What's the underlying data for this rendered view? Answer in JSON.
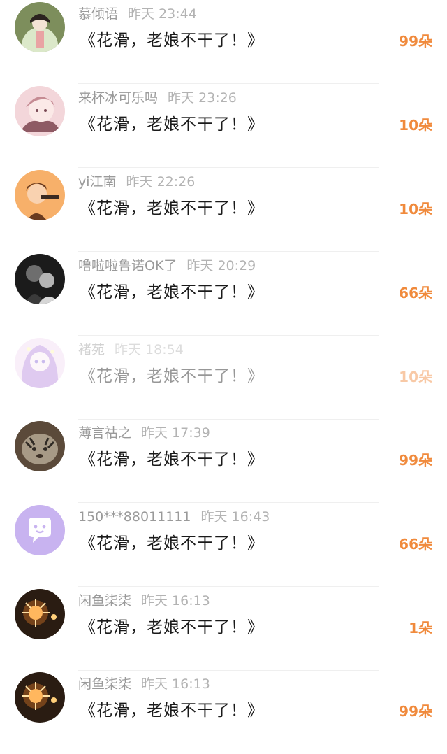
{
  "gifts": [
    {
      "name": "慕倾语",
      "time": "昨天 23:44",
      "message": "《花滑，老娘不干了！》",
      "count": "99朵",
      "avatar": {
        "icon": "avatar-girl-hanfu",
        "colors": [
          "#6a8a4a",
          "#d8e6c8",
          "#f3eee8"
        ]
      }
    },
    {
      "name": "来杯冰可乐吗",
      "time": "昨天 23:26",
      "message": "《花滑，老娘不干了！》",
      "count": "10朵",
      "avatar": {
        "icon": "avatar-anime-girl-pink",
        "colors": [
          "#f2c9cf",
          "#b97b86",
          "#7a4a55"
        ]
      }
    },
    {
      "name": "yi江南",
      "time": "昨天 22:26",
      "message": "《花滑，老娘不干了！》",
      "count": "10朵",
      "avatar": {
        "icon": "avatar-cartoon-boy-orange",
        "colors": [
          "#f5a65b",
          "#6a3b1f",
          "#e55b2a"
        ]
      }
    },
    {
      "name": "噜啦啦鲁诺OK了",
      "time": "昨天 20:29",
      "message": "《花滑，老娘不干了！》",
      "count": "66朵",
      "avatar": {
        "icon": "avatar-couple-dark",
        "colors": [
          "#1d1d1d",
          "#6d6d6d",
          "#d6d6d6"
        ]
      }
    },
    {
      "name": "褚苑",
      "time": "昨天 18:54",
      "message": "《花滑，老娘不干了！》",
      "count": "10朵",
      "avatar": {
        "icon": "avatar-anime-purple-hair",
        "colors": [
          "#c9a0e6",
          "#f4d7ef",
          "#8b6bd8"
        ]
      }
    },
    {
      "name": "薄言祜之",
      "time": "昨天 17:39",
      "message": "《花滑，老娘不干了！》",
      "count": "99朵",
      "avatar": {
        "icon": "avatar-tiger-cub",
        "colors": [
          "#5b4a3a",
          "#a79a86",
          "#2f2a24"
        ]
      }
    },
    {
      "name": "150***88011111",
      "time": "昨天 16:43",
      "message": "《花滑，老娘不干了！》",
      "count": "66朵",
      "avatar": {
        "icon": "avatar-default-chat-bubble",
        "colors": [
          "#c8b3f0",
          "#ffffff"
        ]
      }
    },
    {
      "name": "闲鱼柒柒",
      "time": "昨天 16:13",
      "message": "《花滑，老娘不干了！》",
      "count": "1朵",
      "avatar": {
        "icon": "avatar-sparkler-night",
        "colors": [
          "#2a1c12",
          "#ffcf7a",
          "#ff8a2a"
        ]
      }
    },
    {
      "name": "闲鱼柒柒",
      "time": "昨天 16:13",
      "message": "《花滑，老娘不干了！》",
      "count": "99朵",
      "avatar": {
        "icon": "avatar-sparkler-night",
        "colors": [
          "#2a1c12",
          "#ffcf7a",
          "#ff8a2a"
        ]
      }
    }
  ]
}
